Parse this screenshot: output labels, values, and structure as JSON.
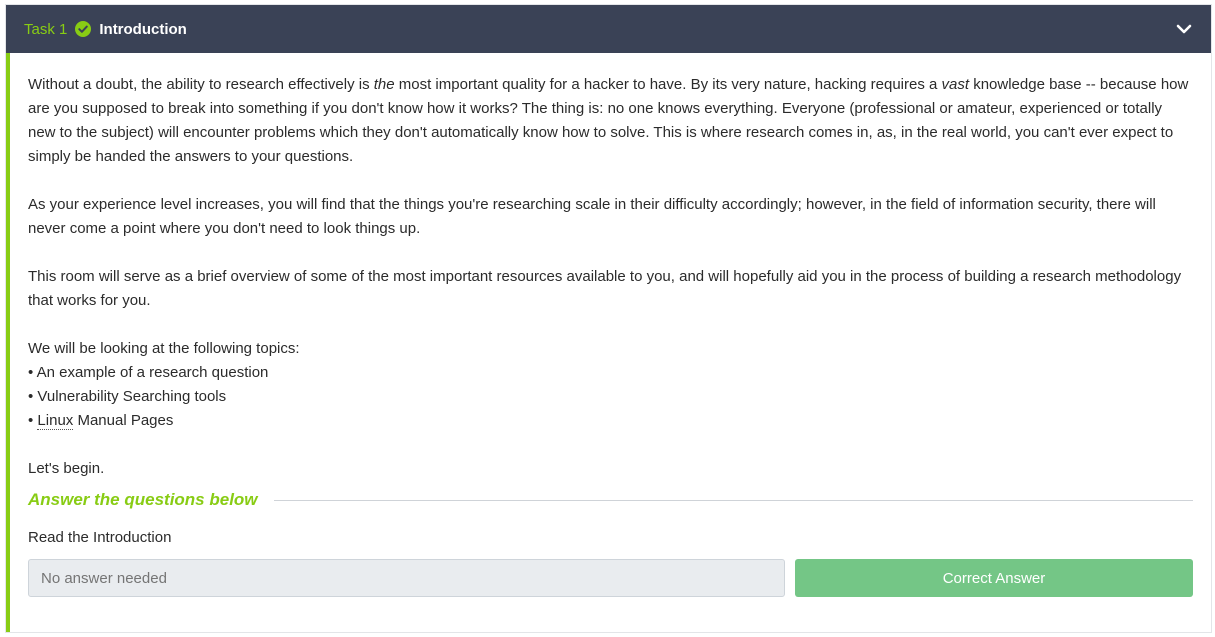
{
  "header": {
    "task_number": "Task 1",
    "title": "Introduction",
    "completed_icon": "check-circle-icon",
    "expand_icon": "chevron-down-icon",
    "bg_color": "#3a4256",
    "accent_color": "#88cc14"
  },
  "body": {
    "para1_a": "Without a doubt, the ability to research effectively is ",
    "para1_em1": "the",
    "para1_b": " most important quality for a hacker to have. By its very nature, hacking requires a ",
    "para1_em2": "vast",
    "para1_c": " knowledge base -- because how are you supposed to break into something if you don't know how it works? The thing is: no one knows everything. Everyone (professional or amateur, experienced or totally new to the subject) will encounter problems which they don't automatically know how to solve. This is where research comes in, as, in the real world, you can't ever expect to simply be handed the answers to your questions.",
    "para2": "As your experience level increases, you will find that the things you're researching scale in their difficulty accordingly; however, in the field of information security, there will never come a point where you don't need to look things up.",
    "para3": "This room will serve as a brief overview of some of the most important resources available to you, and will hopefully aid you in the process of building a research methodology that works for you.",
    "topics_intro": "We will be looking at the following topics:",
    "topic1": "• An example of a research question",
    "topic2": "• Vulnerability Searching tools",
    "topic3_prefix": "• ",
    "topic3_abbr": "Linux",
    "topic3_rest": " Manual Pages",
    "closing": "Let's begin."
  },
  "answers": {
    "heading": "Answer the questions below",
    "question": "Read the Introduction",
    "input_placeholder": "No answer needed",
    "button_label": "Correct Answer",
    "button_color": "#74c686"
  }
}
